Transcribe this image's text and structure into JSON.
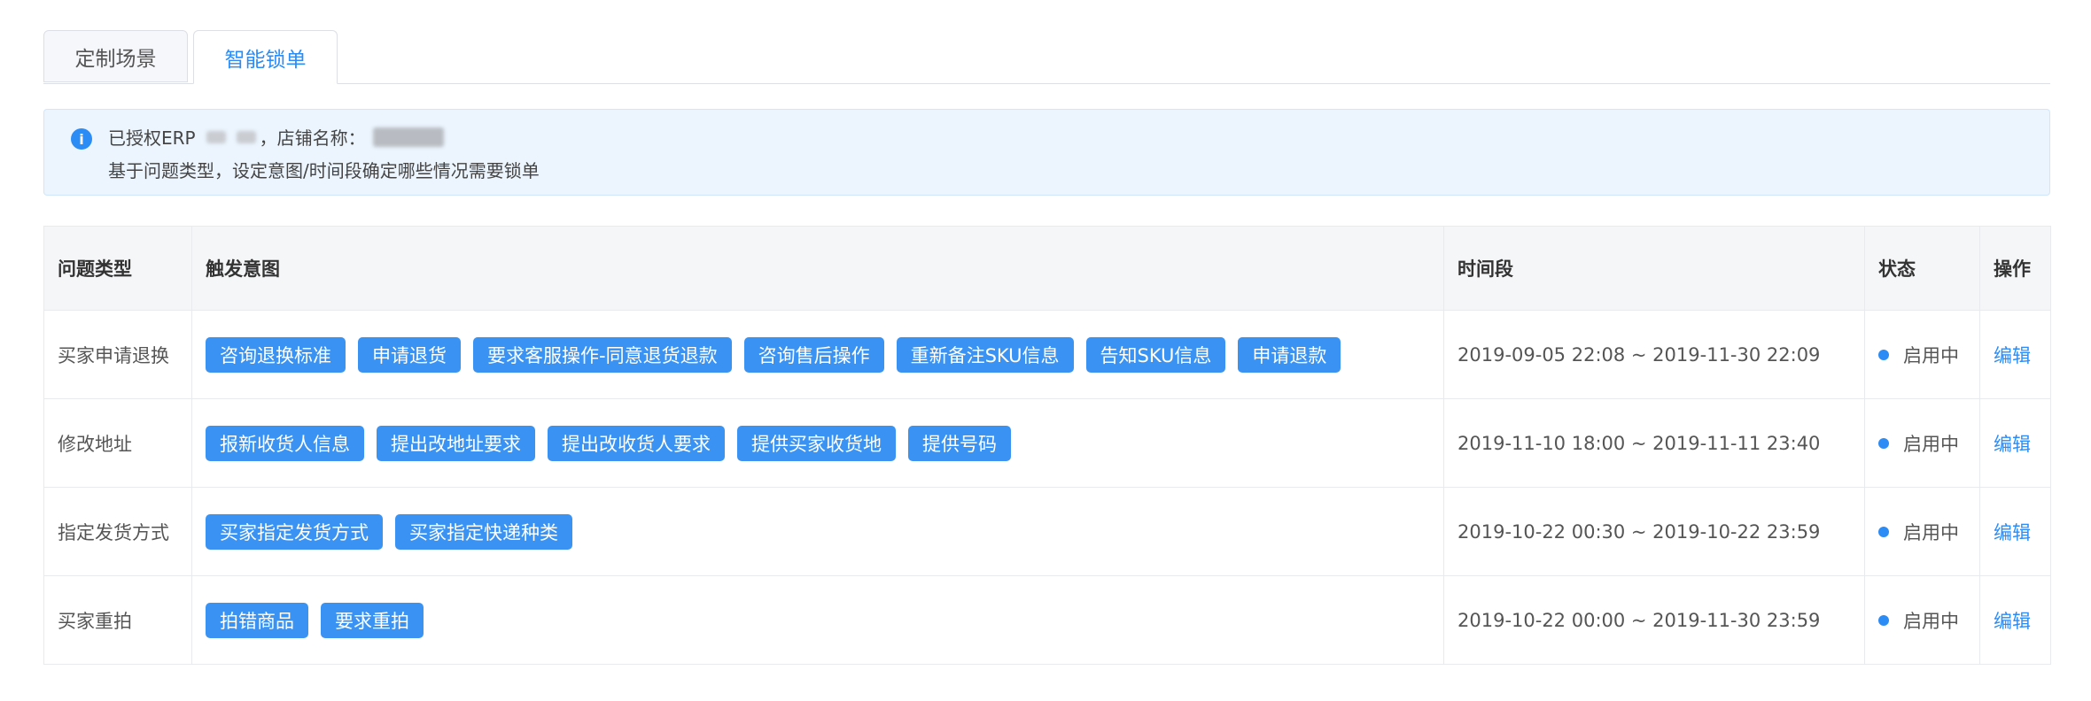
{
  "tabs": [
    {
      "label": "定制场景",
      "active": false
    },
    {
      "label": "智能锁单",
      "active": true
    }
  ],
  "alert": {
    "icon": "info-icon",
    "line1_prefix": "已授权ERP",
    "line1_separator": "，店铺名称：",
    "line2": "基于问题类型，设定意图/时间段确定哪些情况需要锁单"
  },
  "table": {
    "headers": {
      "type": "问题类型",
      "intent": "触发意图",
      "time": "时间段",
      "status": "状态",
      "op": "操作"
    },
    "rows": [
      {
        "type": "买家申请退换",
        "tags": [
          "咨询退换标准",
          "申请退货",
          "要求客服操作-同意退货退款",
          "咨询售后操作",
          "重新备注SKU信息",
          "告知SKU信息",
          "申请退款"
        ],
        "time": "2019-09-05 22:08 ~ 2019-11-30 22:09",
        "status": "启用中",
        "op": "编辑"
      },
      {
        "type": "修改地址",
        "tags": [
          "报新收货人信息",
          "提出改地址要求",
          "提出改收货人要求",
          "提供买家收货地",
          "提供号码"
        ],
        "time": "2019-11-10 18:00 ~ 2019-11-11 23:40",
        "status": "启用中",
        "op": "编辑"
      },
      {
        "type": "指定发货方式",
        "tags": [
          "买家指定发货方式",
          "买家指定快递种类"
        ],
        "time": "2019-10-22 00:30 ~ 2019-10-22 23:59",
        "status": "启用中",
        "op": "编辑"
      },
      {
        "type": "买家重拍",
        "tags": [
          "拍错商品",
          "要求重拍"
        ],
        "time": "2019-10-22 00:00 ~ 2019-11-30 23:59",
        "status": "启用中",
        "op": "编辑"
      }
    ]
  },
  "colors": {
    "accent": "#2c8cf5",
    "tag_bg": "#3a93f3",
    "alert_bg": "#ecf5fe",
    "header_bg": "#f5f6f8"
  }
}
